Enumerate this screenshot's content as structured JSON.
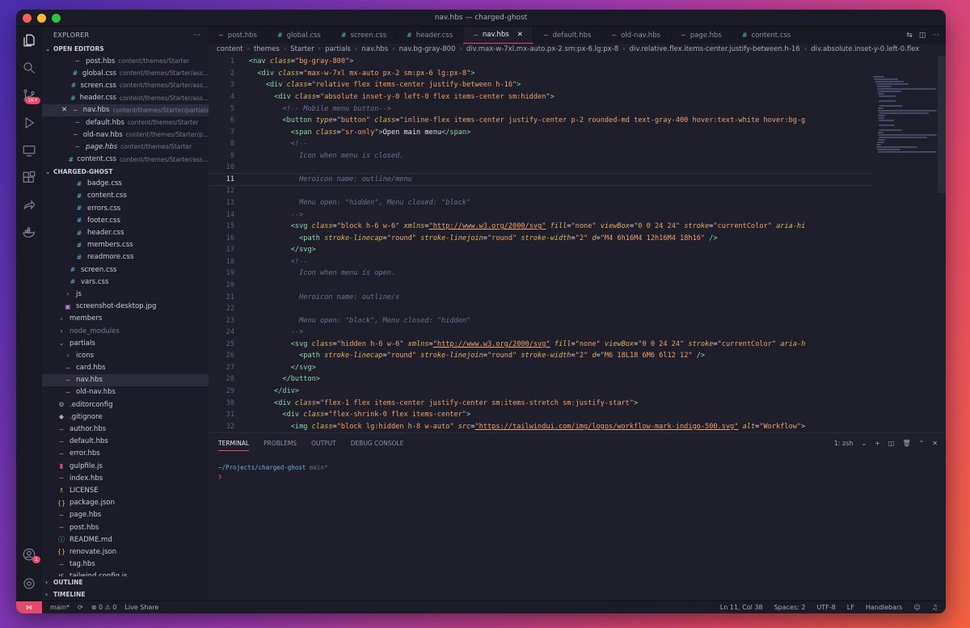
{
  "window": {
    "title": "nav.hbs — charged-ghost",
    "lights": [
      "#ff5f57",
      "#febc2e",
      "#28c840"
    ]
  },
  "accent": "#e8486a",
  "explorer": {
    "title": "EXPLORER",
    "more": "···",
    "open_editors_label": "OPEN EDITORS",
    "open_editors": [
      {
        "icon": "~",
        "color": "#e8896a",
        "name": "post.hbs",
        "path": "content/themes/Starter"
      },
      {
        "icon": "#",
        "color": "#5fb6e0",
        "name": "global.css",
        "path": "content/themes/Starter/ass..."
      },
      {
        "icon": "#",
        "color": "#5fb6e0",
        "name": "screen.css",
        "path": "content/themes/Starter/ass..."
      },
      {
        "icon": "#",
        "color": "#5fb6e0",
        "name": "header.css",
        "path": "content/themes/Starter/ass..."
      },
      {
        "icon": "~",
        "color": "#e8896a",
        "name": "nav.hbs",
        "path": "content/themes/Starter/partials",
        "close": "✕",
        "selected": true
      },
      {
        "icon": "~",
        "color": "#e8896a",
        "name": "default.hbs",
        "path": "content/themes/Starter"
      },
      {
        "icon": "~",
        "color": "#e8896a",
        "name": "old-nav.hbs",
        "path": "content/themes/Starter/p..."
      },
      {
        "icon": "~",
        "color": "#e8896a",
        "name": "page.hbs",
        "path": "content/themes/Starter",
        "italic": true
      },
      {
        "icon": "#",
        "color": "#5fb6e0",
        "name": "content.css",
        "path": "content/themes/Starter/ass..."
      }
    ],
    "project_label": "CHARGED-GHOST",
    "tree": [
      {
        "indent": 36,
        "icon": "#",
        "color": "#5fb6e0",
        "name": "badge.css"
      },
      {
        "indent": 36,
        "icon": "#",
        "color": "#5fb6e0",
        "name": "content.css"
      },
      {
        "indent": 36,
        "icon": "#",
        "color": "#5fb6e0",
        "name": "errors.css"
      },
      {
        "indent": 36,
        "icon": "#",
        "color": "#5fb6e0",
        "name": "footer.css"
      },
      {
        "indent": 36,
        "icon": "#",
        "color": "#5fb6e0",
        "name": "header.css"
      },
      {
        "indent": 36,
        "icon": "#",
        "color": "#5fb6e0",
        "name": "members.css"
      },
      {
        "indent": 36,
        "icon": "#",
        "color": "#5fb6e0",
        "name": "readmore.css"
      },
      {
        "indent": 28,
        "icon": "#",
        "color": "#5fb6e0",
        "name": "screen.css"
      },
      {
        "indent": 28,
        "icon": "#",
        "color": "#5fb6e0",
        "name": "vars.css"
      },
      {
        "indent": 22,
        "icon": "›",
        "color": "#aab",
        "name": "js"
      },
      {
        "indent": 22,
        "icon": "▣",
        "color": "#b585d9",
        "name": "screenshot-desktop.jpg"
      },
      {
        "indent": 14,
        "icon": "›",
        "color": "#aab",
        "name": "members"
      },
      {
        "indent": 14,
        "icon": "›",
        "color": "#aab",
        "name": "node_modules",
        "dim": true
      },
      {
        "indent": 14,
        "icon": "⌄",
        "color": "#aab",
        "name": "partials"
      },
      {
        "indent": 22,
        "icon": "›",
        "color": "#aab",
        "name": "icons"
      },
      {
        "indent": 22,
        "icon": "~",
        "color": "#e8896a",
        "name": "card.hbs"
      },
      {
        "indent": 22,
        "icon": "~",
        "color": "#e8896a",
        "name": "nav.hbs",
        "selected": true
      },
      {
        "indent": 22,
        "icon": "~",
        "color": "#e8896a",
        "name": "old-nav.hbs"
      },
      {
        "indent": 14,
        "icon": "⚙",
        "color": "#aab",
        "name": ".editorconfig"
      },
      {
        "indent": 14,
        "icon": "◆",
        "color": "#aab",
        "name": ".gitignore"
      },
      {
        "indent": 14,
        "icon": "~",
        "color": "#e8896a",
        "name": "author.hbs"
      },
      {
        "indent": 14,
        "icon": "~",
        "color": "#e8896a",
        "name": "default.hbs"
      },
      {
        "indent": 14,
        "icon": "~",
        "color": "#e8896a",
        "name": "error.hbs"
      },
      {
        "indent": 14,
        "icon": "▮",
        "color": "#e8486a",
        "name": "gulpfile.js"
      },
      {
        "indent": 14,
        "icon": "~",
        "color": "#e8896a",
        "name": "index.hbs"
      },
      {
        "indent": 14,
        "icon": "♗",
        "color": "#e2b15b",
        "name": "LICENSE"
      },
      {
        "indent": 14,
        "icon": "{}",
        "color": "#e2b15b",
        "name": "package.json"
      },
      {
        "indent": 14,
        "icon": "~",
        "color": "#e8896a",
        "name": "page.hbs"
      },
      {
        "indent": 14,
        "icon": "~",
        "color": "#e8896a",
        "name": "post.hbs"
      },
      {
        "indent": 14,
        "icon": "ⓘ",
        "color": "#5fb6e0",
        "name": "README.md"
      },
      {
        "indent": 14,
        "icon": "{}",
        "color": "#e2b15b",
        "name": "renovate.json"
      },
      {
        "indent": 14,
        "icon": "~",
        "color": "#e8896a",
        "name": "tag.hbs"
      },
      {
        "indent": 14,
        "icon": "JS",
        "color": "#e2b15b",
        "name": "tailwind.config.js"
      }
    ],
    "outline_label": "OUTLINE",
    "timeline_label": "TIMELINE"
  },
  "activity": {
    "scm_badge": "1K+",
    "account_badge": "1"
  },
  "tabs": [
    {
      "icon": "~",
      "color": "#e8896a",
      "label": "post.hbs"
    },
    {
      "icon": "#",
      "color": "#5fb6e0",
      "label": "global.css"
    },
    {
      "icon": "#",
      "color": "#5fb6e0",
      "label": "screen.css"
    },
    {
      "icon": "#",
      "color": "#5fb6e0",
      "label": "header.css"
    },
    {
      "icon": "~",
      "color": "#e8896a",
      "label": "nav.hbs",
      "active": true,
      "close": "✕"
    },
    {
      "icon": "~",
      "color": "#e8896a",
      "label": "default.hbs"
    },
    {
      "icon": "~",
      "color": "#e8896a",
      "label": "old-nav.hbs"
    },
    {
      "icon": "~",
      "color": "#e8896a",
      "label": "page.hbs"
    },
    {
      "icon": "#",
      "color": "#5fb6e0",
      "label": "content.css"
    }
  ],
  "breadcrumb": [
    "content",
    "themes",
    "Starter",
    "partials",
    "nav.hbs",
    "nav.bg-gray-800",
    "div.max-w-7xl.mx-auto.px-2.sm:px-6.lg:px-8",
    "div.relative.flex.items-center.justify-between.h-16",
    "div.absolute.inset-y-0.left-0.flex"
  ],
  "code": [
    [
      [
        "tg",
        "<nav "
      ],
      [
        "at",
        "class"
      ],
      [
        "tx",
        "="
      ],
      [
        "st",
        "\"bg-gray-800\""
      ],
      [
        "tg",
        ">"
      ]
    ],
    [
      [
        "tx",
        "  "
      ],
      [
        "tg",
        "<div "
      ],
      [
        "at",
        "class"
      ],
      [
        "tx",
        "="
      ],
      [
        "st",
        "\"max-w-7xl mx-auto px-2 sm:px-6 lg:px-8\""
      ],
      [
        "tg",
        ">"
      ]
    ],
    [
      [
        "tx",
        "    "
      ],
      [
        "tg",
        "<div "
      ],
      [
        "at",
        "class"
      ],
      [
        "tx",
        "="
      ],
      [
        "st",
        "\"relative flex items-center justify-between h-16\""
      ],
      [
        "tg",
        ">"
      ]
    ],
    [
      [
        "tx",
        "      "
      ],
      [
        "tg",
        "<div "
      ],
      [
        "at",
        "class"
      ],
      [
        "tx",
        "="
      ],
      [
        "st",
        "\"absolute inset-y-0 left-0 flex items-center sm:hidden\""
      ],
      [
        "tg",
        ">"
      ]
    ],
    [
      [
        "tx",
        "        "
      ],
      [
        "cm",
        "<!-- Mobile menu button-->"
      ]
    ],
    [
      [
        "tx",
        "        "
      ],
      [
        "tg",
        "<button "
      ],
      [
        "at",
        "type"
      ],
      [
        "tx",
        "="
      ],
      [
        "st",
        "\"button\" "
      ],
      [
        "at",
        "class"
      ],
      [
        "tx",
        "="
      ],
      [
        "st",
        "\"inline-flex items-center justify-center p-2 rounded-md text-gray-400 hover:text-white hover:bg-g"
      ]
    ],
    [
      [
        "tx",
        "          "
      ],
      [
        "tg",
        "<span "
      ],
      [
        "at",
        "class"
      ],
      [
        "tx",
        "="
      ],
      [
        "st",
        "\"sr-only\""
      ],
      [
        "tg",
        ">"
      ],
      [
        "tx",
        "Open main menu"
      ],
      [
        "tg",
        "</span>"
      ]
    ],
    [
      [
        "tx",
        "          "
      ],
      [
        "cm",
        "<!--"
      ]
    ],
    [
      [
        "tx",
        "            "
      ],
      [
        "cm",
        "Icon when menu is closed."
      ]
    ],
    [
      [
        "tx",
        ""
      ]
    ],
    [
      [
        "tx",
        "            "
      ],
      [
        "cm",
        "Heroicon name: outline/menu"
      ]
    ],
    [
      [
        "tx",
        ""
      ]
    ],
    [
      [
        "tx",
        "            "
      ],
      [
        "cm",
        "Menu open: \"hidden\", Menu closed: \"block\""
      ]
    ],
    [
      [
        "tx",
        "          "
      ],
      [
        "cm",
        "-->"
      ]
    ],
    [
      [
        "tx",
        "          "
      ],
      [
        "tg",
        "<svg "
      ],
      [
        "at",
        "class"
      ],
      [
        "tx",
        "="
      ],
      [
        "st",
        "\"block h-6 w-6\" "
      ],
      [
        "at",
        "xmlns"
      ],
      [
        "tx",
        "="
      ],
      [
        "url",
        "\"http://www.w3.org/2000/svg\""
      ],
      [
        "tx",
        " "
      ],
      [
        "at",
        "fill"
      ],
      [
        "tx",
        "="
      ],
      [
        "st",
        "\"none\" "
      ],
      [
        "at",
        "viewBox"
      ],
      [
        "tx",
        "="
      ],
      [
        "st",
        "\"0 0 24 24\" "
      ],
      [
        "at",
        "stroke"
      ],
      [
        "tx",
        "="
      ],
      [
        "st",
        "\"currentColor\" "
      ],
      [
        "at",
        "aria-hi"
      ]
    ],
    [
      [
        "tx",
        "            "
      ],
      [
        "tg",
        "<path "
      ],
      [
        "at",
        "stroke-linecap"
      ],
      [
        "tx",
        "="
      ],
      [
        "st",
        "\"round\" "
      ],
      [
        "at",
        "stroke-linejoin"
      ],
      [
        "tx",
        "="
      ],
      [
        "st",
        "\"round\" "
      ],
      [
        "at",
        "stroke-width"
      ],
      [
        "tx",
        "="
      ],
      [
        "st",
        "\"2\" "
      ],
      [
        "at",
        "d"
      ],
      [
        "tx",
        "="
      ],
      [
        "st",
        "\"M4 6h16M4 12h16M4 18h16\""
      ],
      [
        "tg",
        " />"
      ]
    ],
    [
      [
        "tx",
        "          "
      ],
      [
        "tg",
        "</svg>"
      ]
    ],
    [
      [
        "tx",
        "          "
      ],
      [
        "cm",
        "<!--"
      ]
    ],
    [
      [
        "tx",
        "            "
      ],
      [
        "cm",
        "Icon when menu is open."
      ]
    ],
    [
      [
        "tx",
        ""
      ]
    ],
    [
      [
        "tx",
        "            "
      ],
      [
        "cm",
        "Heroicon name: outline/x"
      ]
    ],
    [
      [
        "tx",
        ""
      ]
    ],
    [
      [
        "tx",
        "            "
      ],
      [
        "cm",
        "Menu open: \"block\", Menu closed: \"hidden\""
      ]
    ],
    [
      [
        "tx",
        "          "
      ],
      [
        "cm",
        "-->"
      ]
    ],
    [
      [
        "tx",
        "          "
      ],
      [
        "tg",
        "<svg "
      ],
      [
        "at",
        "class"
      ],
      [
        "tx",
        "="
      ],
      [
        "st",
        "\"hidden h-6 w-6\" "
      ],
      [
        "at",
        "xmlns"
      ],
      [
        "tx",
        "="
      ],
      [
        "url",
        "\"http://www.w3.org/2000/svg\""
      ],
      [
        "tx",
        " "
      ],
      [
        "at",
        "fill"
      ],
      [
        "tx",
        "="
      ],
      [
        "st",
        "\"none\" "
      ],
      [
        "at",
        "viewBox"
      ],
      [
        "tx",
        "="
      ],
      [
        "st",
        "\"0 0 24 24\" "
      ],
      [
        "at",
        "stroke"
      ],
      [
        "tx",
        "="
      ],
      [
        "st",
        "\"currentColor\" "
      ],
      [
        "at",
        "aria-h"
      ]
    ],
    [
      [
        "tx",
        "            "
      ],
      [
        "tg",
        "<path "
      ],
      [
        "at",
        "stroke-linecap"
      ],
      [
        "tx",
        "="
      ],
      [
        "st",
        "\"round\" "
      ],
      [
        "at",
        "stroke-linejoin"
      ],
      [
        "tx",
        "="
      ],
      [
        "st",
        "\"round\" "
      ],
      [
        "at",
        "stroke-width"
      ],
      [
        "tx",
        "="
      ],
      [
        "st",
        "\"2\" "
      ],
      [
        "at",
        "d"
      ],
      [
        "tx",
        "="
      ],
      [
        "st",
        "\"M6 18L18 6M6 6l12 12\""
      ],
      [
        "tg",
        " />"
      ]
    ],
    [
      [
        "tx",
        "          "
      ],
      [
        "tg",
        "</svg>"
      ]
    ],
    [
      [
        "tx",
        "        "
      ],
      [
        "tg",
        "</button>"
      ]
    ],
    [
      [
        "tx",
        "      "
      ],
      [
        "tg",
        "</div>"
      ]
    ],
    [
      [
        "tx",
        "      "
      ],
      [
        "tg",
        "<div "
      ],
      [
        "at",
        "class"
      ],
      [
        "tx",
        "="
      ],
      [
        "st",
        "\"flex-1 flex items-center justify-center sm:items-stretch sm:justify-start\""
      ],
      [
        "tg",
        ">"
      ]
    ],
    [
      [
        "tx",
        "        "
      ],
      [
        "tg",
        "<div "
      ],
      [
        "at",
        "class"
      ],
      [
        "tx",
        "="
      ],
      [
        "st",
        "\"flex-shrink-0 flex items-center\""
      ],
      [
        "tg",
        ">"
      ]
    ],
    [
      [
        "tx",
        "          "
      ],
      [
        "tg",
        "<img "
      ],
      [
        "at",
        "class"
      ],
      [
        "tx",
        "="
      ],
      [
        "st",
        "\"block lg:hidden h-8 w-auto\" "
      ],
      [
        "at",
        "src"
      ],
      [
        "tx",
        "="
      ],
      [
        "url",
        "\"https://tailwindui.com/img/logos/workflow-mark-indigo-500.svg\""
      ],
      [
        "tx",
        " "
      ],
      [
        "at",
        "alt"
      ],
      [
        "tx",
        "="
      ],
      [
        "st",
        "\"Workflow\""
      ],
      [
        "tg",
        ">"
      ]
    ]
  ],
  "current_line": 11,
  "panel": {
    "tabs": [
      "TERMINAL",
      "PROBLEMS",
      "OUTPUT",
      "DEBUG CONSOLE"
    ],
    "shell": "1: zsh",
    "path": "~/Projects/charged-ghost",
    "branch": "main*",
    "prompt": "❯"
  },
  "statusbar": {
    "remote": "⋈",
    "branch": "main*",
    "sync": "⟳",
    "problems": "⊗ 0 ⚠ 0",
    "liveshare": "Live Share",
    "position": "Ln 11, Col 38",
    "spaces": "Spaces: 2",
    "encoding": "UTF-8",
    "eol": "LF",
    "language": "Handlebars"
  }
}
